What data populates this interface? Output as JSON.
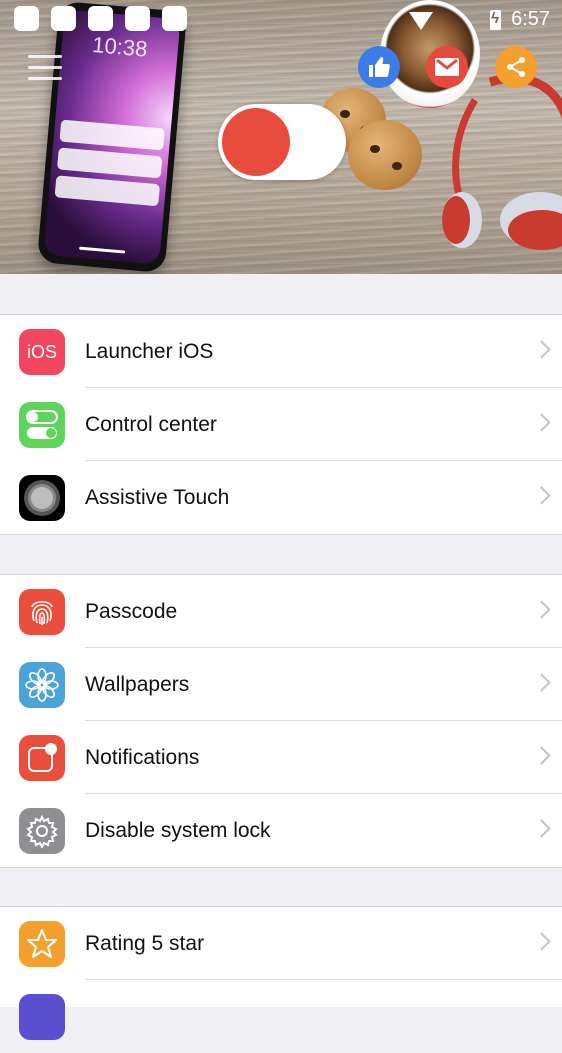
{
  "status_bar": {
    "time": "6:57"
  },
  "banner": {
    "phone_time": "10:38",
    "social": {
      "like_icon": "thumbs-up-icon",
      "mail_icon": "gmail-icon",
      "share_icon": "share-icon"
    },
    "toggle_state": "off"
  },
  "groups": [
    {
      "items": [
        {
          "label": "Launcher iOS",
          "icon": "ios-icon",
          "icon_text": "iOS",
          "color": "#f0475e"
        },
        {
          "label": "Control center",
          "icon": "toggle-switches-icon",
          "color": "#5fd35b"
        },
        {
          "label": "Assistive Touch",
          "icon": "assistive-touch-icon",
          "color": "#000000"
        }
      ]
    },
    {
      "items": [
        {
          "label": "Passcode",
          "icon": "fingerprint-icon",
          "color": "#ea4f3d"
        },
        {
          "label": "Wallpapers",
          "icon": "flower-icon",
          "color": "#4ba3d9"
        },
        {
          "label": "Notifications",
          "icon": "notification-badge-icon",
          "color": "#ea4f3d"
        },
        {
          "label": "Disable system lock",
          "icon": "gear-icon",
          "color": "#8e8e93"
        }
      ]
    },
    {
      "items": [
        {
          "label": "Rating 5 star",
          "icon": "star-icon",
          "color": "#f4a02f"
        }
      ]
    }
  ]
}
